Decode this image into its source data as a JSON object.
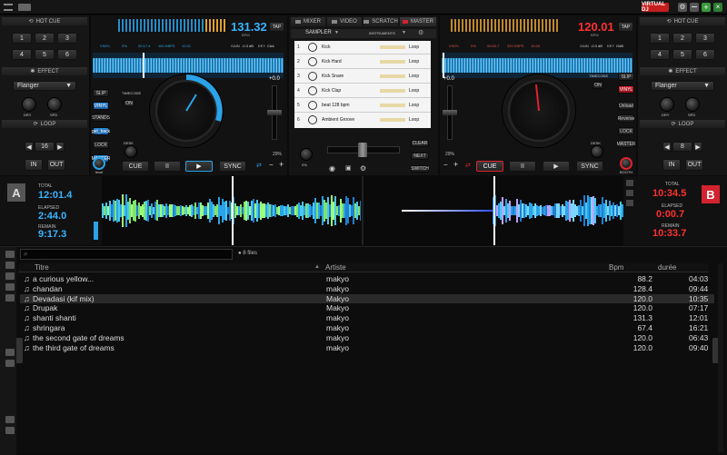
{
  "app": {
    "logo": "VIRTUAL DJ"
  },
  "left_panel": {
    "hotcue_title": "HOT CUE",
    "hotcues": [
      "1",
      "2",
      "3",
      "4",
      "5",
      "6"
    ],
    "effect_title": "EFFECT",
    "effect_value": "Flanger",
    "effect_knobs": [
      "DRY",
      "SPD"
    ],
    "loop_title": "LOOP",
    "loop_value": "16",
    "loop_in": "IN",
    "loop_out": "OUT"
  },
  "right_panel": {
    "hotcue_title": "HOT CUE",
    "hotcues": [
      "1",
      "2",
      "3",
      "4",
      "5",
      "6"
    ],
    "effect_title": "EFFECT",
    "effect_value": "Flanger",
    "effect_knobs": [
      "DRY",
      "SPD"
    ],
    "loop_title": "LOOP",
    "loop_value": "8",
    "loop_in": "IN",
    "loop_out": "OUT"
  },
  "deck_left": {
    "bpm": "131.32",
    "bpm_unit": "BPM",
    "tap": "TAP",
    "info": [
      "VINYL",
      "0%",
      "00:17.4",
      "160 KBPS",
      "12:01"
    ],
    "gain": "GAIN",
    "gain_val": "-0.3 dB",
    "key": "KEY",
    "key_val": "C#A",
    "side_buttons": [
      "SLIP",
      "VINYL",
      "STANDS",
      "get_back",
      "LOCK",
      "MASTER"
    ],
    "timecode": "TIMECODE",
    "on": "ON",
    "desk": "DESK",
    "level": "level",
    "pitch": "+0.0",
    "pitch_range": "29%",
    "transport": [
      "CUE",
      "II",
      "▶",
      "SYNC"
    ],
    "letter": "A",
    "total_label": "TOTAL",
    "total": "12:01.4",
    "elapsed_label": "ELAPSED",
    "elapsed": "2:44.0",
    "remain_label": "REMAIN",
    "remain": "9:17.3"
  },
  "deck_right": {
    "bpm": "120.01",
    "bpm_unit": "BPM",
    "tap": "TAP",
    "info": [
      "VINYL",
      "0%",
      "00:00.7",
      "320 KBPS",
      "10:34"
    ],
    "gain": "GAIN",
    "gain_val": "-0.3 dB",
    "key": "KEY",
    "key_val": "G#B",
    "side_buttons": [
      "SLIP",
      "VINYL",
      "Unload",
      "Reverse",
      "LOCK",
      "MASTER"
    ],
    "timecode": "TIMECODE",
    "on": "ON",
    "desk": "DESK",
    "booth": "BOOTH",
    "pitch": "+0.0",
    "pitch_range": "29%",
    "transport": [
      "CUE",
      "II",
      "▶",
      "SYNC"
    ],
    "letter": "B",
    "total_label": "TOTAL",
    "total": "10:34.5",
    "elapsed_label": "ELAPSED",
    "elapsed": "0:00.7",
    "remain_label": "REMAIN",
    "remain": "10:33.7"
  },
  "center": {
    "tabs": [
      "MIXER",
      "VIDEO",
      "SCRATCH",
      "MASTER"
    ],
    "sampler_title": "SAMPLER",
    "sampler_mode": "INSTRUMENTS",
    "samples": [
      {
        "num": "1",
        "name": "Kick",
        "mode": "Loop"
      },
      {
        "num": "2",
        "name": "Kick Hard",
        "mode": "Loop"
      },
      {
        "num": "3",
        "name": "Kick Snare",
        "mode": "Loop"
      },
      {
        "num": "4",
        "name": "Kick Clap",
        "mode": "Loop"
      },
      {
        "num": "5",
        "name": "beat 128 bpm",
        "mode": "Loop"
      },
      {
        "num": "6",
        "name": "Ambient Groove",
        "mode": "Loop"
      }
    ],
    "right_btns": [
      "CLEAR",
      "NEXT",
      "SWITCH"
    ],
    "volume_label": "0%"
  },
  "browser": {
    "search_placeholder": "",
    "file_count": "8 files",
    "columns": [
      "Titre",
      "Artiste",
      "Bpm",
      "durée"
    ],
    "rows": [
      [
        "a curious yellow...",
        "makyo",
        "88.2",
        "04:03"
      ],
      [
        "chandan",
        "makyo",
        "128.4",
        "09:44"
      ],
      [
        "Devadasi (kif mix)",
        "Makyo",
        "120.0",
        "10:35"
      ],
      [
        "Drupak",
        "Makyo",
        "120.0",
        "07:17"
      ],
      [
        "shanti shanti",
        "makyo",
        "131.3",
        "12:01"
      ],
      [
        "shringara",
        "makyo",
        "67.4",
        "16:21"
      ],
      [
        "the second gate of dreams",
        "makyo",
        "120.0",
        "06:43"
      ],
      [
        "the third gate of dreams",
        "makyo",
        "120.0",
        "09:40"
      ]
    ],
    "left_tab": "folders",
    "right_tab": "sideview"
  },
  "colors": {
    "accent_blue": "#2aa3e8",
    "accent_red": "#e0222e",
    "bpm_blue": "#39b4ff",
    "bpm_red": "#ff3030"
  }
}
